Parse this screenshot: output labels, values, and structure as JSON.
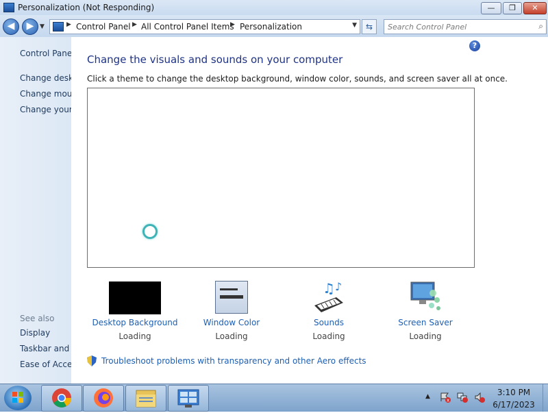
{
  "window": {
    "title": "Personalization (Not Responding)",
    "minimize": "—",
    "maximize": "❐",
    "close": "✕"
  },
  "addressbar": {
    "breadcrumbs": [
      "Control Panel",
      "All Control Panel Items",
      "Personalization"
    ],
    "back": "◀",
    "forward": "▶",
    "dropdown": "▼",
    "refresh": "⇆"
  },
  "search": {
    "placeholder": "Search Control Panel",
    "icon": "search-icon"
  },
  "sidebar": {
    "links": [
      "Control Panel Home",
      "Change desktop icons",
      "Change mouse pointers",
      "Change your account picture"
    ],
    "see_also_label": "See also",
    "see_also": [
      "Display",
      "Taskbar and Start Menu",
      "Ease of Access Center"
    ]
  },
  "main": {
    "title": "Change the visuals and sounds on your computer",
    "subtitle": "Click a theme to change the desktop background, window color, sounds, and screen saver all at once.",
    "help_icon": "?",
    "items": [
      {
        "label": "Desktop Background",
        "status": "Loading"
      },
      {
        "label": "Window Color",
        "status": "Loading"
      },
      {
        "label": "Sounds",
        "status": "Loading"
      },
      {
        "label": "Screen Saver",
        "status": "Loading"
      }
    ],
    "troubleshoot": "Troubleshoot problems with transparency and other Aero effects"
  },
  "taskbar": {
    "apps": [
      "chrome-icon",
      "firefox-icon",
      "file-explorer-icon",
      "control-panel-icon"
    ],
    "time": "3:10 PM",
    "date": "6/17/2023",
    "tray_expand": "▲"
  },
  "colors": {
    "link": "#1c5fb4",
    "title": "#1e3287",
    "close_button": "#c4402c"
  }
}
